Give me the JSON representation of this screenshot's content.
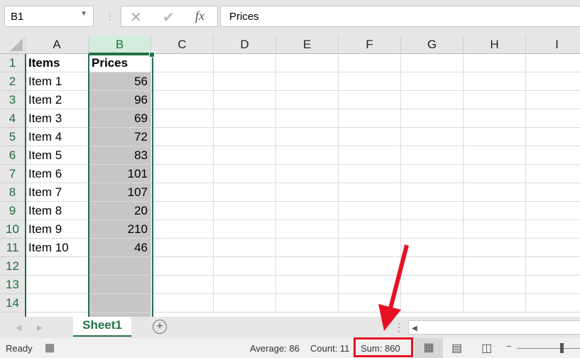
{
  "formula_bar": {
    "name_box": "B1",
    "formula_value": "Prices",
    "cancel_icon": "x-icon",
    "enter_icon": "check-icon",
    "function_icon": "fx-icon"
  },
  "columns": [
    "A",
    "B",
    "C",
    "D",
    "E",
    "F",
    "G",
    "H",
    "I"
  ],
  "rows": [
    {
      "n": "1",
      "a": "Items",
      "b": "Prices"
    },
    {
      "n": "2",
      "a": "Item 1",
      "b": "56"
    },
    {
      "n": "3",
      "a": "Item 2",
      "b": "96"
    },
    {
      "n": "4",
      "a": "Item 3",
      "b": "69"
    },
    {
      "n": "5",
      "a": "Item 4",
      "b": "72"
    },
    {
      "n": "6",
      "a": "Item 5",
      "b": "83"
    },
    {
      "n": "7",
      "a": "Item 6",
      "b": "101"
    },
    {
      "n": "8",
      "a": "Item 7",
      "b": "107"
    },
    {
      "n": "9",
      "a": "Item 8",
      "b": "20"
    },
    {
      "n": "10",
      "a": "Item 9",
      "b": "210"
    },
    {
      "n": "11",
      "a": "Item 10",
      "b": "46"
    },
    {
      "n": "12",
      "a": "",
      "b": ""
    },
    {
      "n": "13",
      "a": "",
      "b": ""
    },
    {
      "n": "14",
      "a": "",
      "b": ""
    }
  ],
  "tabs": {
    "active": "Sheet1"
  },
  "status": {
    "ready": "Ready",
    "average": "Average: 86",
    "count": "Count: 11",
    "sum": "Sum: 860"
  },
  "colors": {
    "accent": "#217346",
    "highlight": "#e81123"
  }
}
